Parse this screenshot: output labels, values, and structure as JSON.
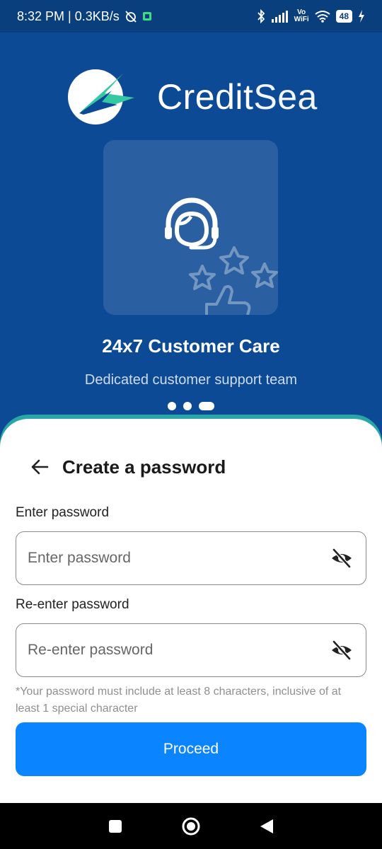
{
  "status": {
    "time_speed": "8:32 PM | 0.3KB/s",
    "vo_label": "Vo",
    "wifi_label": "WiFi",
    "battery": "48"
  },
  "brand": {
    "name_bold": "Credit",
    "name_light": "Sea"
  },
  "feature": {
    "title": "24x7 Customer Care",
    "subtitle": "Dedicated customer support team",
    "icon": "customer-support-icon",
    "page_count": 3,
    "active_index": 2
  },
  "form": {
    "title": "Create a password",
    "password_label": "Enter password",
    "password_placeholder": "Enter password",
    "reenter_label": "Re-enter password",
    "reenter_placeholder": "Re-enter password",
    "hint": "*Your password must include at least 8 characters, inclusive of at least 1 special character",
    "proceed_label": "Proceed"
  },
  "colors": {
    "hero_bg": "#0d4a96",
    "accent": "#0a84ff",
    "sheet_edge": "#2aa6a8"
  },
  "icons": [
    "back-arrow-icon",
    "eye-off-icon",
    "square-icon",
    "circle-icon",
    "triangle-back-icon"
  ]
}
